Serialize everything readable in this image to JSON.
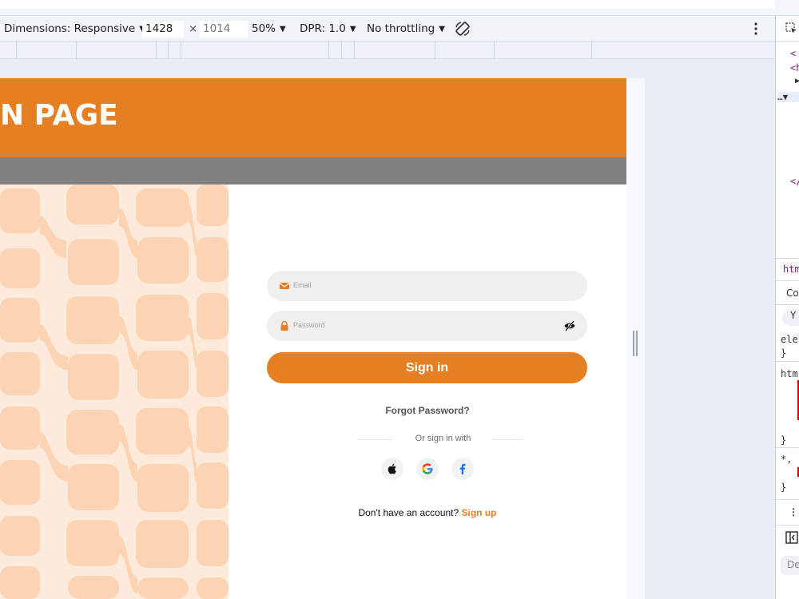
{
  "toolbar": {
    "dimensions_label": "Dimensions: Responsive",
    "width_value": "1428",
    "times": "×",
    "height_value": "1014",
    "zoom_label": "50%",
    "dpr_label": "DPR: 1.0",
    "throttle_label": "No throttling",
    "rotate_icon": "rotate-icon",
    "menu_icon": "kebab-menu-icon"
  },
  "page": {
    "header_title": "N PAGE",
    "email_placeholder": "Email",
    "password_placeholder": "Password",
    "signin_label": "Sign in",
    "forgot_label": "Forgot Password?",
    "or_text": "Or sign in with",
    "social": [
      "apple-icon",
      "google-icon",
      "facebook-icon"
    ],
    "signup_prefix": "Don't have an account? ",
    "signup_link": "Sign up",
    "accent": "#e67e22",
    "pattern_color": "#fdd4b3"
  },
  "devtools": {
    "lines": [
      "<",
      "<h",
      "▶",
      "…▼",
      "</",
      "htm",
      "Co",
      "Y",
      "ele",
      "}",
      "htm",
      "}",
      "*,",
      "}",
      "⋮",
      "De"
    ]
  }
}
